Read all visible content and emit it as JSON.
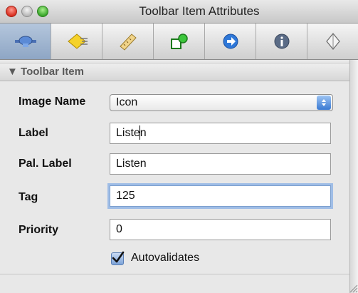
{
  "window": {
    "title": "Toolbar Item Attributes"
  },
  "tabs": [
    {
      "icon": "toolbar-item-icon",
      "active": true
    },
    {
      "icon": "diamond-lines-icon",
      "active": false
    },
    {
      "icon": "ruler-icon",
      "active": false
    },
    {
      "icon": "shapes-icon",
      "active": false
    },
    {
      "icon": "arrow-circle-icon",
      "active": false
    },
    {
      "icon": "info-icon",
      "active": false
    },
    {
      "icon": "pen-nib-icon",
      "active": false
    }
  ],
  "section": {
    "toggle": "▼",
    "title": "Toolbar Item"
  },
  "form": {
    "image_name": {
      "label": "Image Name",
      "value": "Icon"
    },
    "label": {
      "label": "Label",
      "value": "Listen"
    },
    "pal_label": {
      "label": "Pal. Label",
      "value": "Listen"
    },
    "tag": {
      "label": "Tag",
      "value": "125"
    },
    "priority": {
      "label": "Priority",
      "value": "0"
    },
    "autovalidates": {
      "label": "Autovalidates",
      "checked": true
    }
  },
  "colors": {
    "active_tab": "#9fb6d4",
    "focus_ring": "#9fbde6",
    "close": "#d92f20",
    "zoom": "#3aa62b"
  }
}
